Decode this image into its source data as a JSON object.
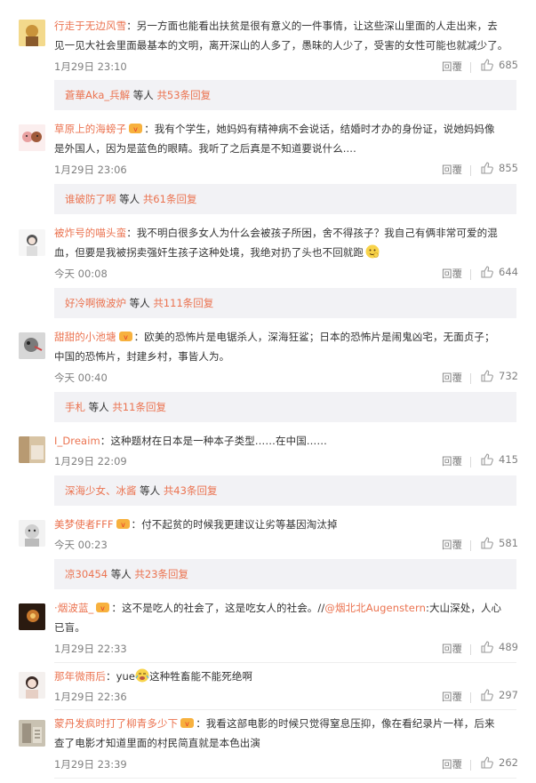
{
  "comments": [
    {
      "user": "行走于无边风雪",
      "lines": [
        "：另一方面也能看出扶贫是很有意义的一件事情，让这些深山里面的人走出来，去",
        "见一见大社会里面最基本的文明，离开深山的人多了，愚昧的人少了，受害的女性可能也就减少了。"
      ],
      "time": "1月29日 23:10",
      "reply": "回覆",
      "likes": "685",
      "sub": {
        "names": "蒼華Aka_兵解",
        "etc": " 等人 ",
        "count": "共53条回复"
      }
    },
    {
      "user": "草原上的海螃子",
      "lines": [
        "：我有个学生，她妈妈有精神病不会说话，结婚时才办的身份证，说她妈妈像",
        "是外国人，因为是蓝色的眼睛。我听了之后真是不知道要说什么...."
      ],
      "time": "1月29日 23:06",
      "reply": "回覆",
      "likes": "855",
      "sub": {
        "names": "谁破防了啊",
        "etc": " 等人 ",
        "count": "共61条回复"
      }
    },
    {
      "user": "被炸号的喵头蛮",
      "lines": [
        "：我不明白很多女人为什么会被孩子所困，舍不得孩子？我自己有俩非常可爱的混",
        "血，但要是我被拐卖强奸生孩子这种处境，我绝对扔了头也不回就跑"
      ],
      "time": "今天 00:08",
      "reply": "回覆",
      "likes": "644",
      "sub": {
        "names": "好冷啊微波炉",
        "etc": " 等人 ",
        "count": "共111条回复"
      }
    },
    {
      "user": "甜甜的小池塘",
      "lines": [
        "：欧美的恐怖片是电锯杀人，深海狂鲨；日本的恐怖片是闹鬼凶宅，无面贞子；",
        "中国的恐怖片，封建乡村，事皆人为。"
      ],
      "time": "今天 00:40",
      "reply": "回覆",
      "likes": "732",
      "sub": {
        "names": "手札",
        "etc": " 等人 ",
        "count": "共11条回复"
      }
    },
    {
      "user": "I_Dreaim",
      "lines": [
        "：这种题材在日本是一种本子类型……在中国……"
      ],
      "time": "1月29日 22:09",
      "reply": "回覆",
      "likes": "415",
      "sub": {
        "names": "深海少女、冰酱",
        "etc": " 等人 ",
        "count": "共43条回复"
      }
    },
    {
      "user": "美梦使者FFF",
      "lines": [
        "：付不起贫的时候我更建议让劣等基因淘汰掉"
      ],
      "time": "今天 00:23",
      "reply": "回覆",
      "likes": "581",
      "sub": {
        "names": "凉30454",
        "etc": " 等人 ",
        "count": "共23条回复"
      }
    },
    {
      "user": "·烟波蓝_",
      "lines": [
        "：这不是吃人的社会了，这是吃女人的社会。//",
        "已盲。"
      ],
      "mention": "@烟北北Augenstern",
      "mention_tail": ":大山深处，人心",
      "time": "1月29日 22:33",
      "reply": "回覆",
      "likes": "489"
    },
    {
      "user": "那年微雨后",
      "lines": [
        "：yue",
        "这种牲畜能不能死绝啊"
      ],
      "time": "1月29日 22:36",
      "reply": "回覆",
      "likes": "297"
    },
    {
      "user": "蒙丹发疯时打了柳青多少下",
      "lines": [
        "：我看这部电影的时候只觉得窒息压抑，像在看纪录片一样，后来",
        "查了电影才知道里面的村民简直就是本色出演"
      ],
      "time": "1月29日 23:39",
      "reply": "回覆",
      "likes": "262"
    }
  ],
  "colors": {
    "username": "#eb7350",
    "meta": "#808080",
    "subbar_bg": "#f2f2f5"
  }
}
